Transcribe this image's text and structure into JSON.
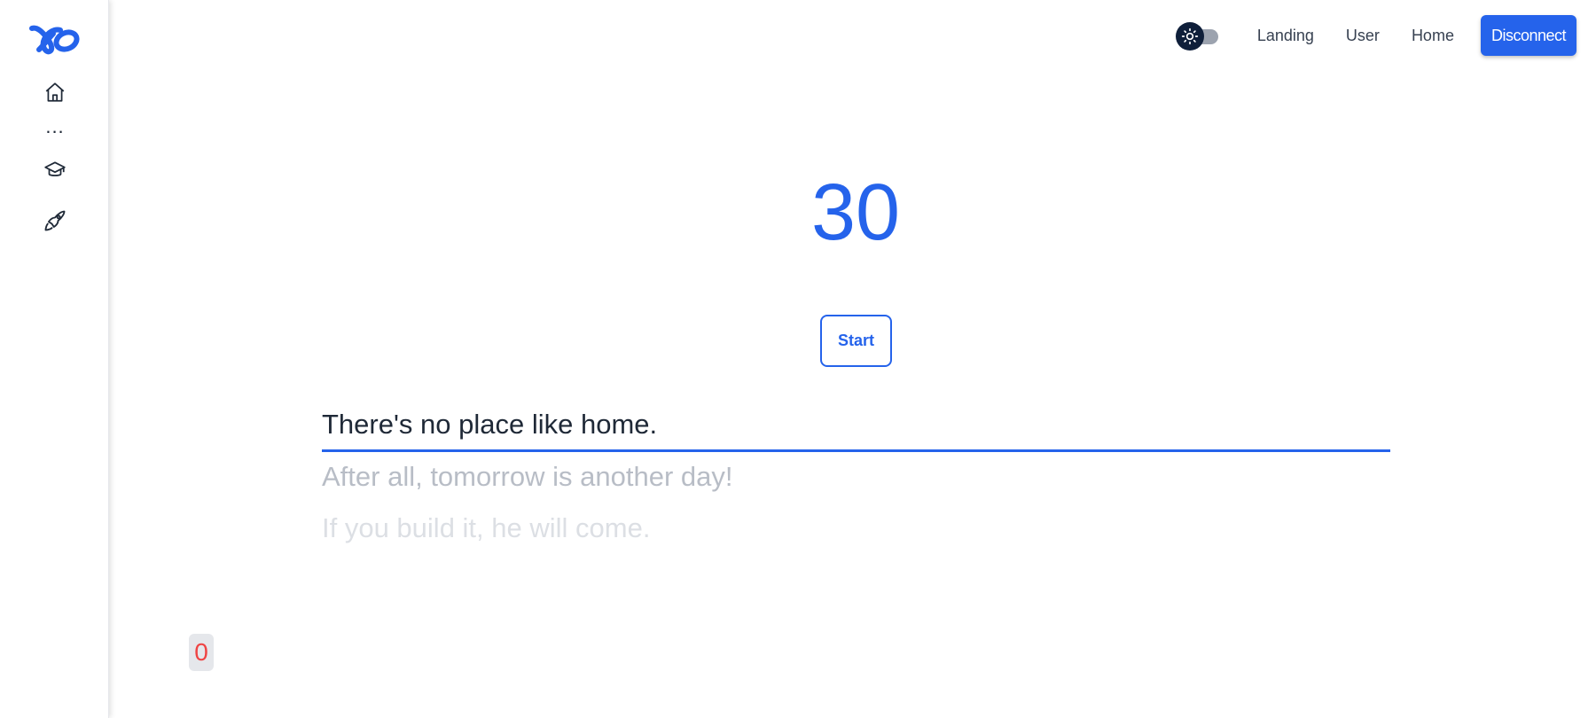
{
  "sidebar": {
    "logo_icon": "brand-logo",
    "items": [
      {
        "icon": "home-icon"
      },
      {
        "icon": "more-dots"
      },
      {
        "icon": "graduation-cap-icon"
      },
      {
        "icon": "rocket-icon"
      }
    ],
    "more_label": "..."
  },
  "header": {
    "theme_toggle_icon": "sun-icon",
    "nav": [
      "Landing",
      "User",
      "Home"
    ],
    "disconnect_label": "Disconnect"
  },
  "main": {
    "timer": "30",
    "start_label": "Start",
    "lines": [
      "There's no place like home.",
      "After all, tomorrow is another day!",
      "If you build it, he will come."
    ],
    "score": "0"
  },
  "colors": {
    "accent": "#2563eb",
    "score": "#ef4444",
    "toggle_knob": "#0f1f3a"
  }
}
